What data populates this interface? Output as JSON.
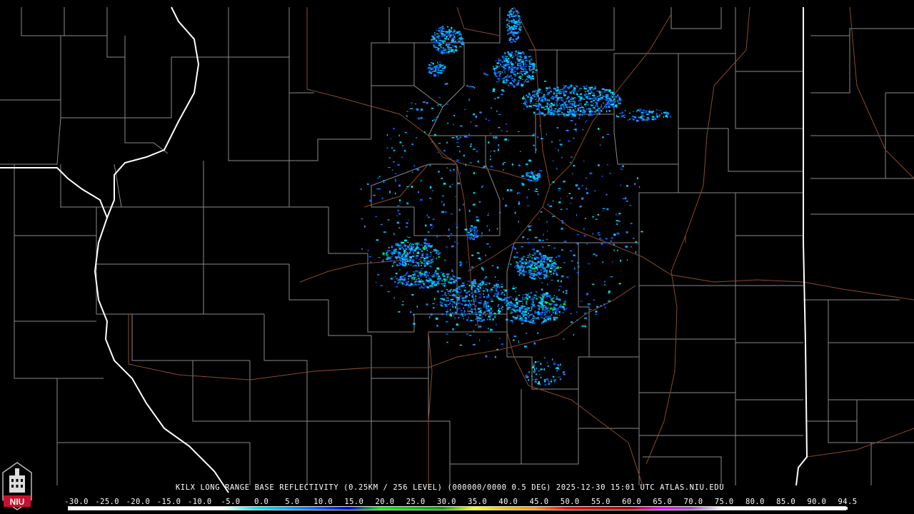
{
  "product": {
    "caption": "KILX LONG RANGE BASE REFLECTIVITY (0.25KM / 256 LEVEL) (000000/0000 0.5 DEG) 2025-12-30 15:01 UTC  ATLAS.NIU.EDU"
  },
  "logo": {
    "text": "NIU",
    "color": "#c8102e"
  },
  "legend": {
    "labels": [
      "-30.0",
      "-25.0",
      "-20.0",
      "-15.0",
      "-10.0",
      "-5.0",
      "0.0",
      "5.0",
      "10.0",
      "15.0",
      "20.0",
      "25.0",
      "30.0",
      "35.0",
      "40.0",
      "45.0",
      "50.0",
      "55.0",
      "60.0",
      "65.0",
      "70.0",
      "75.0",
      "80.0",
      "85.0",
      "90.0",
      "94.5"
    ],
    "colors": [
      "#ffffff",
      "#ffffff",
      "#ffffff",
      "#ffffff",
      "#ffffff",
      "#ffffff",
      "#00e8e8",
      "#00a8ff",
      "#0060ff",
      "#0000e0",
      "#00f000",
      "#00c800",
      "#00a000",
      "#ffff00",
      "#e8c000",
      "#ff9000",
      "#ff0000",
      "#d00000",
      "#b00000",
      "#ff00ff",
      "#9955c8",
      "#ffffff",
      "#ffffff",
      "#ffffff",
      "#ffffff",
      "#ffffff"
    ]
  },
  "map_colors": {
    "background": "#000000",
    "county_lines": "#8a8a8a",
    "state_lines": "#ffffff",
    "highways": "#8b4a2b"
  }
}
